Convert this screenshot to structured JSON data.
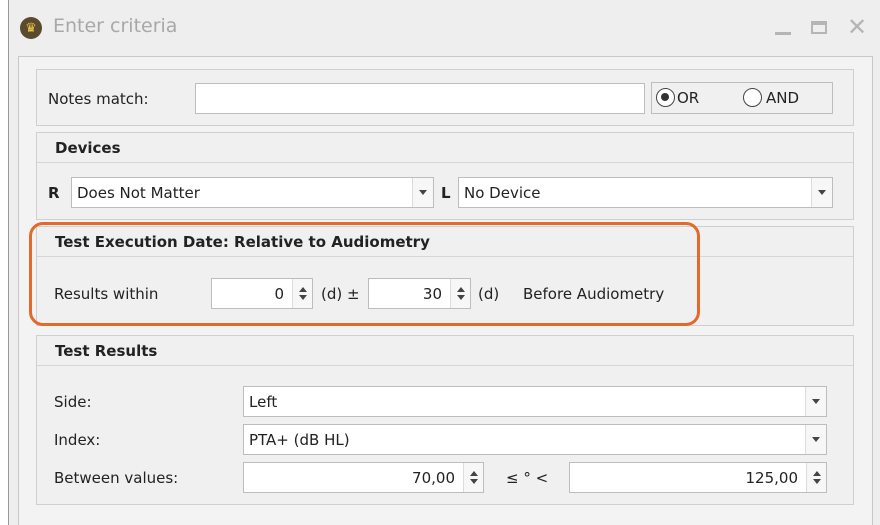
{
  "window": {
    "title": "Enter criteria",
    "accent": "#e26a2c"
  },
  "notes": {
    "label": "Notes match:",
    "value": "",
    "options": [
      {
        "label": "OR",
        "checked": true
      },
      {
        "label": "AND",
        "checked": false
      }
    ]
  },
  "devices": {
    "header": "Devices",
    "right": {
      "side": "R",
      "value": "Does Not Matter"
    },
    "left": {
      "side": "L",
      "value": "No Device"
    }
  },
  "execution": {
    "header": "Test Execution Date: Relative to Audiometry",
    "label": "Results within",
    "value1": "0",
    "unit1": "(d) ±",
    "value2": "30",
    "unit2": "(d)",
    "suffix": "Before Audiometry"
  },
  "results": {
    "header": "Test Results",
    "side_label": "Side:",
    "side_value": "Left",
    "index_label": "Index:",
    "index_value": "PTA+ (dB HL)",
    "between_label": "Between values:",
    "min_value": "70,00",
    "operator": "≤ ° <",
    "max_value": "125,00"
  }
}
